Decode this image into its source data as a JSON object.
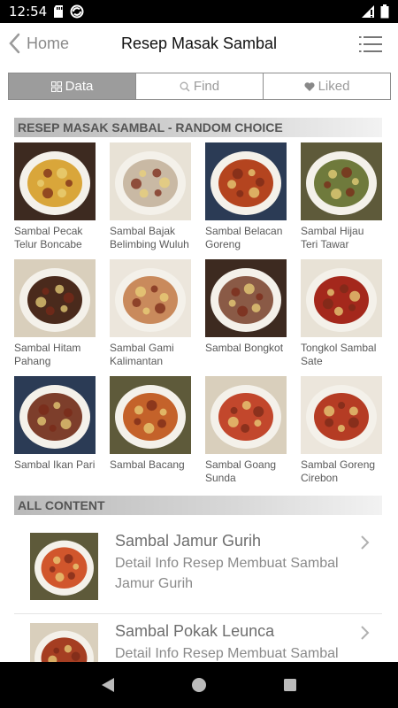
{
  "status_bar": {
    "time": "12:54",
    "icons_left": [
      "sd-card-icon",
      "sync-icon"
    ],
    "icons_right": [
      "signal-icon",
      "battery-icon"
    ]
  },
  "header": {
    "back_label": "Home",
    "title": "Resep Masak Sambal"
  },
  "tabs": [
    {
      "label": "Data",
      "icon": "grid-icon",
      "active": true
    },
    {
      "label": "Find",
      "icon": "search-icon",
      "active": false
    },
    {
      "label": "Liked",
      "icon": "heart-icon",
      "active": false
    }
  ],
  "random_section": {
    "title": "RESEP MASAK SAMBAL - RANDOM CHOICE",
    "items": [
      {
        "caption": "Sambal Pecak Telur Boncabe",
        "color": "#d9a63a"
      },
      {
        "caption": "Sambal Bajak Belimbing Wuluh",
        "color": "#c9b9a4"
      },
      {
        "caption": "Sambal Belacan Goreng",
        "color": "#b4441f"
      },
      {
        "caption": "Sambal Hijau Teri Tawar",
        "color": "#6f7a3c"
      },
      {
        "caption": "Sambal Hitam Pahang",
        "color": "#4a2a1c"
      },
      {
        "caption": "Sambal Gami Kalimantan",
        "color": "#c98a5c"
      },
      {
        "caption": "Sambal Bongkot",
        "color": "#8a5a46"
      },
      {
        "caption": "Tongkol Sambal Sate",
        "color": "#a4281c"
      },
      {
        "caption": "Sambal Ikan Pari",
        "color": "#7d3e2b"
      },
      {
        "caption": "Sambal Bacang",
        "color": "#c4622a"
      },
      {
        "caption": "Sambal Goang Sunda",
        "color": "#c2472c"
      },
      {
        "caption": "Sambal Goreng Cirebon",
        "color": "#b53c24"
      }
    ]
  },
  "all_content": {
    "title": "ALL CONTENT",
    "items": [
      {
        "title": "Sambal Jamur Gurih",
        "description": "Detail Info Resep Membuat Sambal Jamur Gurih",
        "color": "#d1562c"
      },
      {
        "title": "Sambal Pokak Leunca",
        "description": "Detail Info Resep Membuat Sambal Pokak Leunca",
        "color": "#a53e22"
      }
    ]
  },
  "colors": {
    "active_tab": "#9c9c9c",
    "section_header_text": "#555555"
  }
}
